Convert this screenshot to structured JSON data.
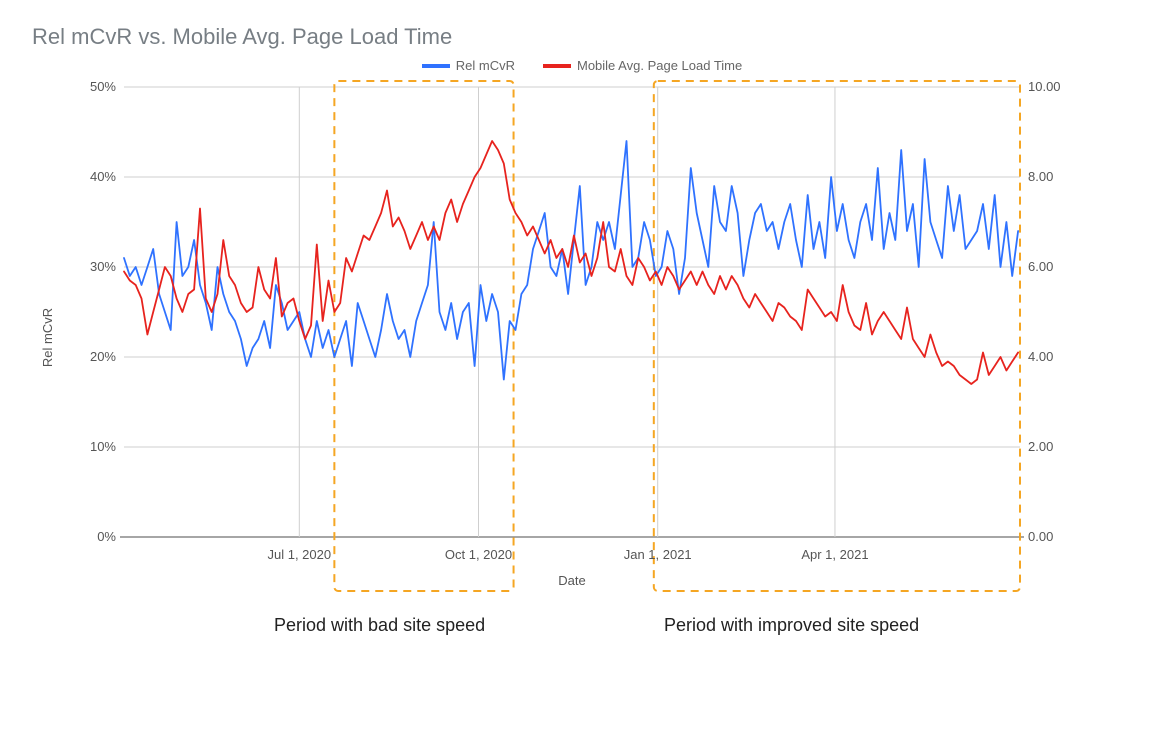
{
  "chart_data": {
    "type": "line",
    "title": "Rel mCvR vs. Mobile Avg. Page Load Time",
    "xlabel": "Date",
    "ylabel_left": "Rel mCvR",
    "ylabel_right": "",
    "y_left": {
      "min": 0,
      "max": 50,
      "unit": "%",
      "ticks": [
        0,
        10,
        20,
        30,
        40,
        50
      ],
      "tick_labels": [
        "0%",
        "10%",
        "20%",
        "30%",
        "40%",
        "50%"
      ]
    },
    "y_right": {
      "min": 0.0,
      "max": 10.0,
      "ticks": [
        0.0,
        2.0,
        4.0,
        6.0,
        8.0,
        10.0
      ],
      "tick_labels": [
        "0.00",
        "2.00",
        "4.00",
        "6.00",
        "8.00",
        "10.00"
      ]
    },
    "x": {
      "min": 0,
      "max": 460,
      "tick_positions": [
        90,
        182,
        274,
        365
      ],
      "tick_labels": [
        "Jul 1, 2020",
        "Oct 1, 2020",
        "Jan 1, 2021",
        "Apr 1, 2021"
      ]
    },
    "legend": [
      {
        "name": "Rel mCvR",
        "color": "#2f72ff"
      },
      {
        "name": "Mobile Avg. Page Load Time",
        "color": "#e7231e"
      }
    ],
    "series": [
      {
        "name": "Rel mCvR",
        "axis": "left",
        "color": "#2f72ff",
        "x": [
          0,
          3,
          6,
          9,
          12,
          15,
          18,
          21,
          24,
          27,
          30,
          33,
          36,
          39,
          42,
          45,
          48,
          51,
          54,
          57,
          60,
          63,
          66,
          69,
          72,
          75,
          78,
          81,
          84,
          87,
          90,
          93,
          96,
          99,
          102,
          105,
          108,
          111,
          114,
          117,
          120,
          123,
          126,
          129,
          132,
          135,
          138,
          141,
          144,
          147,
          150,
          153,
          156,
          159,
          162,
          165,
          168,
          171,
          174,
          177,
          180,
          183,
          186,
          189,
          192,
          195,
          198,
          201,
          204,
          207,
          210,
          213,
          216,
          219,
          222,
          225,
          228,
          231,
          234,
          237,
          240,
          243,
          246,
          249,
          252,
          255,
          258,
          261,
          264,
          267,
          270,
          273,
          276,
          279,
          282,
          285,
          288,
          291,
          294,
          297,
          300,
          303,
          306,
          309,
          312,
          315,
          318,
          321,
          324,
          327,
          330,
          333,
          336,
          339,
          342,
          345,
          348,
          351,
          354,
          357,
          360,
          363,
          366,
          369,
          372,
          375,
          378,
          381,
          384,
          387,
          390,
          393,
          396,
          399,
          402,
          405,
          408,
          411,
          414,
          417,
          420,
          423,
          426,
          429,
          432,
          435,
          438,
          441,
          444,
          447,
          450,
          453,
          456,
          459
        ],
        "values": [
          31,
          29,
          30,
          28,
          30,
          32,
          27,
          25,
          23,
          35,
          29,
          30,
          33,
          28,
          26,
          23,
          30,
          27,
          25,
          24,
          22,
          19,
          21,
          22,
          24,
          21,
          28,
          26,
          23,
          24,
          25,
          22,
          20,
          24,
          21,
          23,
          20,
          22,
          24,
          19,
          26,
          24,
          22,
          20,
          23,
          27,
          24,
          22,
          23,
          20,
          24,
          26,
          28,
          35,
          25,
          23,
          26,
          22,
          25,
          26,
          19,
          28,
          24,
          27,
          25,
          17.5,
          24,
          23,
          27,
          28,
          32,
          34,
          36,
          30,
          29,
          32,
          27,
          33,
          39,
          28,
          30,
          35,
          33,
          35,
          32,
          38,
          44,
          30,
          31,
          35,
          33,
          29,
          30,
          34,
          32,
          27,
          31,
          41,
          36,
          33,
          30,
          39,
          35,
          34,
          39,
          36,
          29,
          33,
          36,
          37,
          34,
          35,
          32,
          35,
          37,
          33,
          30,
          38,
          32,
          35,
          31,
          40,
          34,
          37,
          33,
          31,
          35,
          37,
          33,
          41,
          32,
          36,
          33,
          43,
          34,
          37,
          30,
          42,
          35,
          33,
          31,
          39,
          34,
          38,
          32,
          33,
          34,
          37,
          32,
          38,
          30,
          35,
          29,
          34
        ]
      },
      {
        "name": "Mobile Avg. Page Load Time",
        "axis": "right",
        "color": "#e7231e",
        "x": [
          0,
          3,
          6,
          9,
          12,
          15,
          18,
          21,
          24,
          27,
          30,
          33,
          36,
          39,
          42,
          45,
          48,
          51,
          54,
          57,
          60,
          63,
          66,
          69,
          72,
          75,
          78,
          81,
          84,
          87,
          90,
          93,
          96,
          99,
          102,
          105,
          108,
          111,
          114,
          117,
          120,
          123,
          126,
          129,
          132,
          135,
          138,
          141,
          144,
          147,
          150,
          153,
          156,
          159,
          162,
          165,
          168,
          171,
          174,
          177,
          180,
          183,
          186,
          189,
          192,
          195,
          198,
          201,
          204,
          207,
          210,
          213,
          216,
          219,
          222,
          225,
          228,
          231,
          234,
          237,
          240,
          243,
          246,
          249,
          252,
          255,
          258,
          261,
          264,
          267,
          270,
          273,
          276,
          279,
          282,
          285,
          288,
          291,
          294,
          297,
          300,
          303,
          306,
          309,
          312,
          315,
          318,
          321,
          324,
          327,
          330,
          333,
          336,
          339,
          342,
          345,
          348,
          351,
          354,
          357,
          360,
          363,
          366,
          369,
          372,
          375,
          378,
          381,
          384,
          387,
          390,
          393,
          396,
          399,
          402,
          405,
          408,
          411,
          414,
          417,
          420,
          423,
          426,
          429,
          432,
          435,
          438,
          441,
          444,
          447,
          450,
          453,
          456,
          459
        ],
        "values": [
          5.9,
          5.7,
          5.6,
          5.3,
          4.5,
          5.0,
          5.5,
          6.0,
          5.8,
          5.3,
          5.0,
          5.4,
          5.5,
          7.3,
          5.3,
          5.0,
          5.4,
          6.6,
          5.8,
          5.6,
          5.2,
          5.0,
          5.1,
          6.0,
          5.5,
          5.3,
          6.2,
          4.9,
          5.2,
          5.3,
          4.8,
          4.4,
          4.7,
          6.5,
          4.8,
          5.7,
          5.0,
          5.2,
          6.2,
          5.9,
          6.3,
          6.7,
          6.6,
          6.9,
          7.2,
          7.7,
          6.9,
          7.1,
          6.8,
          6.4,
          6.7,
          7.0,
          6.6,
          6.9,
          6.6,
          7.2,
          7.5,
          7.0,
          7.4,
          7.7,
          8.0,
          8.2,
          8.5,
          8.8,
          8.6,
          8.3,
          7.5,
          7.2,
          7.0,
          6.7,
          6.9,
          6.6,
          6.3,
          6.6,
          6.2,
          6.4,
          6.0,
          6.7,
          6.1,
          6.3,
          5.8,
          6.2,
          7.0,
          6.0,
          5.9,
          6.4,
          5.8,
          5.6,
          6.2,
          6.0,
          5.7,
          5.9,
          5.6,
          6.0,
          5.8,
          5.5,
          5.7,
          5.9,
          5.6,
          5.9,
          5.6,
          5.4,
          5.8,
          5.5,
          5.8,
          5.6,
          5.3,
          5.1,
          5.4,
          5.2,
          5.0,
          4.8,
          5.2,
          5.1,
          4.9,
          4.8,
          4.6,
          5.5,
          5.3,
          5.1,
          4.9,
          5.0,
          4.8,
          5.6,
          5.0,
          4.7,
          4.6,
          5.2,
          4.5,
          4.8,
          5.0,
          4.8,
          4.6,
          4.4,
          5.1,
          4.4,
          4.2,
          4.0,
          4.5,
          4.1,
          3.8,
          3.9,
          3.8,
          3.6,
          3.5,
          3.4,
          3.5,
          4.1,
          3.6,
          3.8,
          4.0,
          3.7,
          3.9,
          4.1
        ]
      }
    ],
    "highlight_regions": [
      {
        "label": "Period with bad site speed",
        "x_start": 108,
        "x_end": 200,
        "stroke": "#f5a623"
      },
      {
        "label": "Period with improved site speed",
        "x_start": 272,
        "x_end": 460,
        "stroke": "#f5a623"
      }
    ]
  },
  "annotations": {
    "bad": "Period with bad site speed",
    "improved": "Period with improved site speed"
  },
  "axis_xlabel": "Date"
}
